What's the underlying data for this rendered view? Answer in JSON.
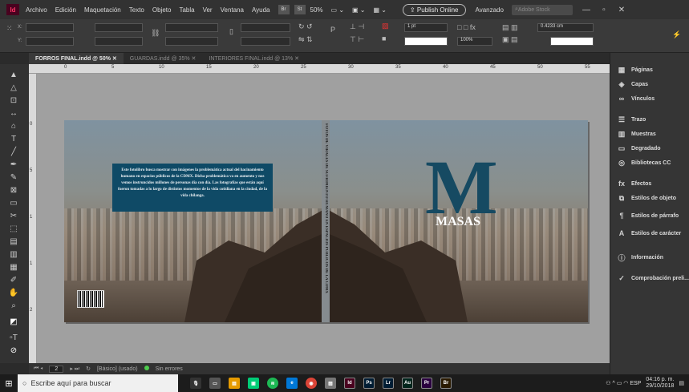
{
  "app": {
    "logo": "Id"
  },
  "menu": [
    "Archivo",
    "Edición",
    "Maquetación",
    "Texto",
    "Objeto",
    "Tabla",
    "Ver",
    "Ventana",
    "Ayuda"
  ],
  "menubar_right": {
    "br_label": "Br",
    "st_label": "St",
    "zoom": "50%",
    "publish_label": "Publish Online",
    "workspace": "Avanzado",
    "search_placeholder": "Adobe Stock"
  },
  "controlbar": {
    "x_label": "X:",
    "y_label": "Y:",
    "stroke_weight": "1 pt",
    "opacity": "100%",
    "gap_value": "0.4233 cm"
  },
  "tabs": [
    {
      "label": "FORROS FINAL.indd @ 50%",
      "active": true
    },
    {
      "label": "GUARDAS.indd @ 35%",
      "active": false
    },
    {
      "label": "INTERIORES FINAL.indd @ 13%",
      "active": false
    }
  ],
  "ruler_marks": [
    "0",
    "5",
    "10",
    "15",
    "20",
    "25",
    "30",
    "35",
    "40",
    "45",
    "50",
    "55"
  ],
  "vruler_marks": [
    "0",
    "5",
    "1",
    "1",
    "2"
  ],
  "document": {
    "spine_text": "FOTOS DE VIRALES DE SUFRIMIENTO HUMANO EN ESPACIOS PÚBLICOS DE LA CDMX",
    "back_text": "Este fotolibro busca mostrar con imágenes la problemática actual del hacinamiento humano en espacios públicos de la CDMX. Dicha problemática va en aumento y nos vemos instruncidos millones de personas día con día. Las fotografías que están aquí fueron tomadas a lo largo de distintos momentos de la vida cotidiana en la ciudad, de la vida chilanga.",
    "cover_letter": "M",
    "cover_title": "MASAS"
  },
  "statusbar": {
    "page": "2",
    "preflight_profile": "[Básico] (usado)",
    "errors": "Sin errores"
  },
  "panels": [
    {
      "label": "Páginas",
      "icon": "pages-icon",
      "glyph": "▦"
    },
    {
      "label": "Capas",
      "icon": "layers-icon",
      "glyph": "◈"
    },
    {
      "label": "Vínculos",
      "icon": "links-icon",
      "glyph": "∞"
    },
    {
      "label": "Trazo",
      "icon": "stroke-icon",
      "glyph": "☰"
    },
    {
      "label": "Muestras",
      "icon": "swatches-icon",
      "glyph": "▥"
    },
    {
      "label": "Degradado",
      "icon": "gradient-icon",
      "glyph": "▭"
    },
    {
      "label": "Bibliotecas CC",
      "icon": "cc-libraries-icon",
      "glyph": "◎"
    },
    {
      "label": "Efectos",
      "icon": "effects-icon",
      "glyph": "fx"
    },
    {
      "label": "Estilos de objeto",
      "icon": "object-styles-icon",
      "glyph": "⧉"
    },
    {
      "label": "Estilos de párrafo",
      "icon": "paragraph-styles-icon",
      "glyph": "¶"
    },
    {
      "label": "Estilos de carácter",
      "icon": "character-styles-icon",
      "glyph": "A"
    },
    {
      "label": "Información",
      "icon": "info-icon",
      "glyph": "ⓘ"
    },
    {
      "label": "Comprobación preli...",
      "icon": "preflight-icon",
      "glyph": "✓"
    }
  ],
  "taskbar": {
    "search_placeholder": "Escribe aquí para buscar",
    "lang": "ESP",
    "time": "04:16 p. m.",
    "date": "29/10/2018",
    "apps": [
      {
        "label": "Id",
        "color": "#49021f",
        "name": "indesign-taskbar-icon"
      },
      {
        "label": "Ps",
        "color": "#001d34",
        "name": "photoshop-taskbar-icon"
      },
      {
        "label": "Lr",
        "color": "#001d34",
        "name": "lightroom-taskbar-icon"
      },
      {
        "label": "Au",
        "color": "#00251c",
        "name": "audition-taskbar-icon"
      },
      {
        "label": "Pr",
        "color": "#2a003f",
        "name": "premiere-taskbar-icon"
      },
      {
        "label": "Br",
        "color": "#2a1a00",
        "name": "bridge-taskbar-icon"
      }
    ]
  },
  "colors": {
    "cover_blue": "#164a62",
    "textbox_blue": "#0f4a66",
    "indesign_pink": "#ff3366"
  }
}
